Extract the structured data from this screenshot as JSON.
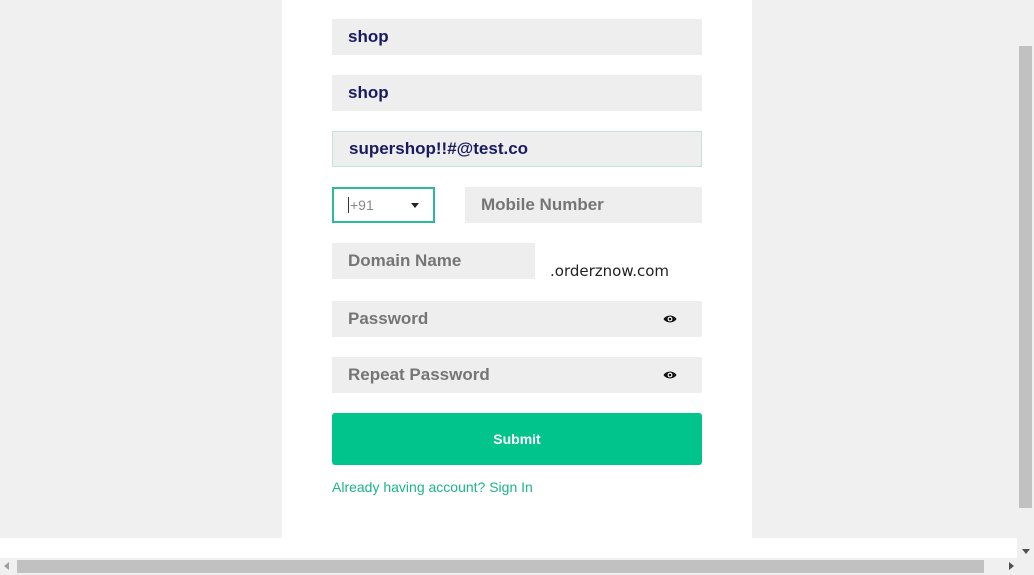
{
  "form": {
    "first_name_value": "shop",
    "last_name_value": "shop",
    "email_value": "supershop!!#@test.co",
    "country_code_value": "+91",
    "mobile_placeholder": "Mobile Number",
    "domain_placeholder": "Domain Name",
    "domain_suffix": ".orderznow.com",
    "password_placeholder": "Password",
    "repeat_password_placeholder": "Repeat Password",
    "submit_label": "Submit",
    "signin_link": "Already having account? Sign In"
  },
  "icons": {
    "password_toggle": "eye-icon",
    "dropdown": "chevron-down-icon"
  },
  "colors": {
    "accent": "#00c48c",
    "link": "#1bb48c",
    "field_bg": "#eeeeee",
    "value_text": "#1a1a5e"
  }
}
